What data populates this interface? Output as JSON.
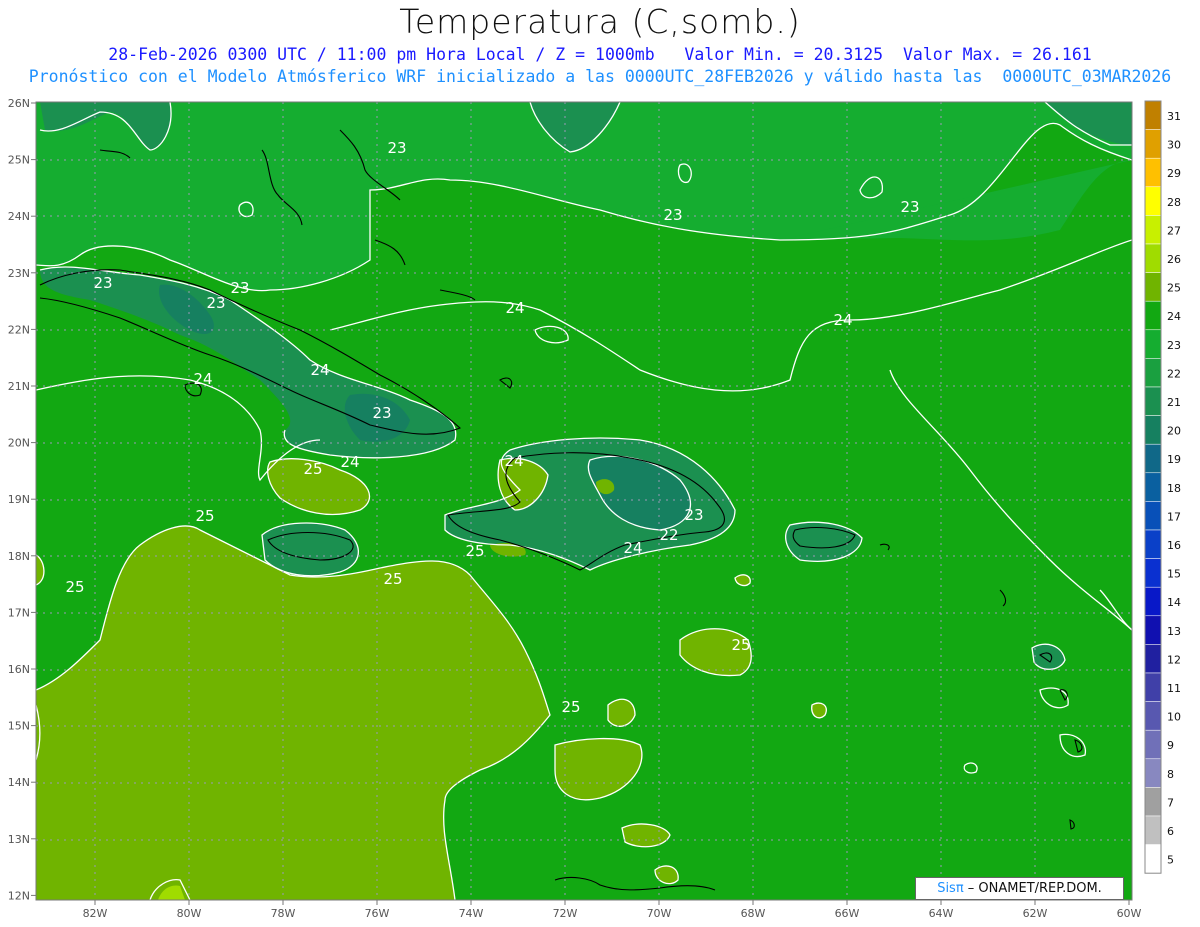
{
  "header": {
    "title": "Temperatura (C,somb.)",
    "line1": "28-Feb-2026 0300 UTC / 11:00 pm Hora Local / Z = 1000mb   Valor Min. = 20.3125  Valor Max. = 26.161",
    "line2": "Pronóstico con el Modelo Atmósferico WRF inicializado a las 0000UTC_28FEB2026 y válido hasta las  0000UTC_03MAR2026"
  },
  "credit": {
    "brand": "Sisπ",
    "text": " – ONAMET/REP.DOM."
  },
  "lat_labels": [
    "26N",
    "25N",
    "24N",
    "23N",
    "22N",
    "21N",
    "20N",
    "19N",
    "18N",
    "17N",
    "16N",
    "15N",
    "14N",
    "13N",
    "12N"
  ],
  "lon_labels": [
    "82W",
    "80W",
    "78W",
    "76W",
    "74W",
    "72W",
    "70W",
    "68W",
    "66W",
    "64W",
    "62W",
    "60W"
  ],
  "colorbar": {
    "levels": [
      "31",
      "30",
      "29",
      "28",
      "27",
      "26",
      "25",
      "24",
      "23",
      "22",
      "21",
      "20",
      "19",
      "18",
      "17",
      "16",
      "15",
      "14",
      "13",
      "12",
      "11",
      "10",
      "9",
      "8",
      "7",
      "6",
      "5"
    ],
    "colors": [
      "#c08000",
      "#e0a000",
      "#ffc000",
      "#ffff00",
      "#c8f000",
      "#a0dc00",
      "#70b400",
      "#12a812",
      "#15ad30",
      "#1aa040",
      "#1b9050",
      "#168060",
      "#106888",
      "#0a60a0",
      "#0850b8",
      "#0a40c8",
      "#0a30d0",
      "#0818c8",
      "#1010b0",
      "#2020a0",
      "#4040a8",
      "#5858b0",
      "#7070b8",
      "#8888c0",
      "#a0a0a0",
      "#c0c0c0",
      "#ffffff"
    ]
  },
  "contour_labels": [
    {
      "value": "23"
    },
    {
      "value": "23"
    },
    {
      "value": "23"
    },
    {
      "value": "23"
    },
    {
      "value": "23"
    },
    {
      "value": "23"
    },
    {
      "value": "23"
    },
    {
      "value": "23"
    },
    {
      "value": "22"
    },
    {
      "value": "24"
    },
    {
      "value": "24"
    },
    {
      "value": "24"
    },
    {
      "value": "24"
    },
    {
      "value": "24"
    },
    {
      "value": "24"
    },
    {
      "value": "24"
    },
    {
      "value": "25"
    },
    {
      "value": "25"
    },
    {
      "value": "25"
    },
    {
      "value": "25"
    },
    {
      "value": "25"
    },
    {
      "value": "25"
    },
    {
      "value": "25"
    }
  ]
}
